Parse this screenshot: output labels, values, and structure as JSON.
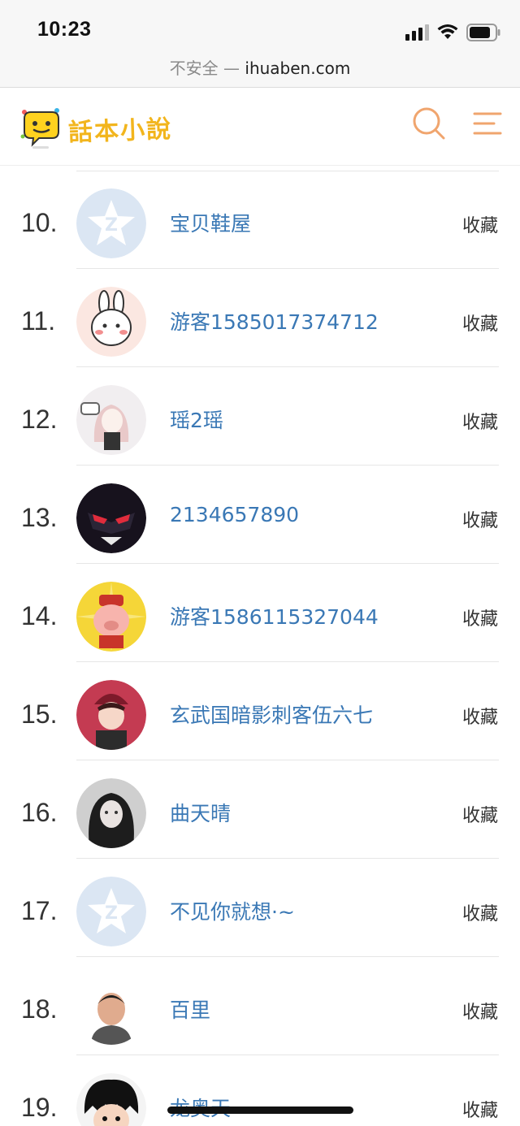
{
  "status_bar": {
    "time": "10:23"
  },
  "address_bar": {
    "insecure_label": "不安全",
    "separator": "—",
    "domain": "ihuaben.com"
  },
  "header": {
    "logo_text": "話本小說"
  },
  "fav_label": "收藏",
  "members": [
    {
      "rank": "10.",
      "name": "宝贝鞋屋",
      "avatar": "default"
    },
    {
      "rank": "11.",
      "name": "游客1585017374712",
      "avatar": "rabbit"
    },
    {
      "rank": "12.",
      "name": "瑶2瑶",
      "avatar": "girl-sketch"
    },
    {
      "rank": "13.",
      "name": "2134657890",
      "avatar": "dark-mask"
    },
    {
      "rank": "14.",
      "name": "游客1586115327044",
      "avatar": "fortune-pig"
    },
    {
      "rank": "15.",
      "name": "玄武国暗影刺客伍六七",
      "avatar": "red-boy"
    },
    {
      "rank": "16.",
      "name": "曲天晴",
      "avatar": "dark-hair-girl"
    },
    {
      "rank": "17.",
      "name": "不见你就想·~",
      "avatar": "default"
    },
    {
      "rank": "18.",
      "name": "百里",
      "avatar": "photo-boy"
    },
    {
      "rank": "19.",
      "name": "龙奥天",
      "avatar": "cartoon-boy"
    }
  ]
}
